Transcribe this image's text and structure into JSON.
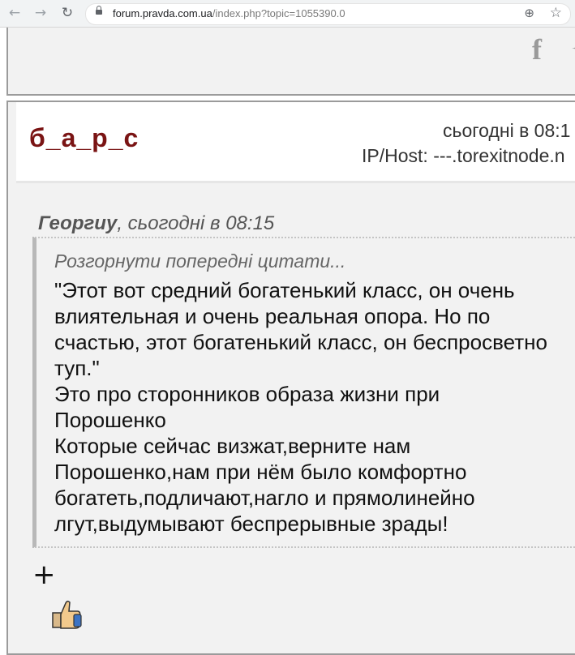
{
  "browser": {
    "url_host": "forum.pravda.com.ua",
    "url_path": "/index.php?topic=1055390.0"
  },
  "post": {
    "author": "б_а_р_с",
    "date": "сьогодні в 08:1",
    "ip_host": "IP/Host: ---.torexitnode.n"
  },
  "quote": {
    "author": "Георгиу",
    "time": ", сьогодні в 08:15",
    "expand_label": "Розгорнути попередні цитати...",
    "text": "\"Этот вот средний богатенький класс, он очень влиятельная и очень реальная опора. Но по счастью, этот богатенький класс, он беспросветно туп.\"\n Это  про сторонников образа жизни при Порошенко\n Которые сейчас визжат,верните нам Порошенко,нам при нём было комфортно богатеть,подличают,нагло и прямолинейно лгут,выдумывают беспрерывные зрады!"
  },
  "icons": {
    "back": "arrow-left-icon",
    "forward": "arrow-right-icon",
    "reload": "reload-icon",
    "lock": "lock-icon",
    "zoom": "zoom-icon",
    "bookmark": "star-icon",
    "facebook": "facebook-icon",
    "twitter": "twitter-icon",
    "plus": "plus-icon",
    "like": "thumbs-up-icon"
  },
  "colors": {
    "username": "#7a1414",
    "panel_bg": "#f2f2f2",
    "border": "#9b9b9b"
  }
}
